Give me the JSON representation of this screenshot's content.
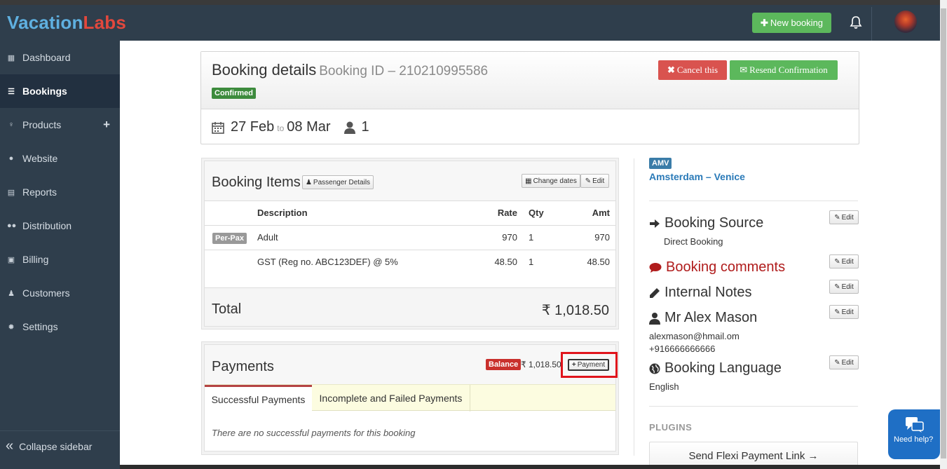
{
  "brand": {
    "part1": "Vacation",
    "part2": "Labs"
  },
  "topbar": {
    "new_booking_label": "New booking",
    "bell_icon": "bell-icon",
    "avatar": "user-avatar"
  },
  "sidebar": {
    "items": [
      {
        "label": "Dashboard",
        "icon": "dashboard-icon"
      },
      {
        "label": "Bookings",
        "icon": "list-icon",
        "active": true
      },
      {
        "label": "Products",
        "icon": "lightbulb-icon"
      },
      {
        "label": "Website",
        "icon": "globe-icon"
      },
      {
        "label": "Reports",
        "icon": "report-icon"
      },
      {
        "label": "Distribution",
        "icon": "users-icon"
      },
      {
        "label": "Billing",
        "icon": "money-icon"
      },
      {
        "label": "Customers",
        "icon": "user-icon"
      },
      {
        "label": "Settings",
        "icon": "gear-icon"
      }
    ],
    "collapse_label": "Collapse sidebar"
  },
  "header": {
    "title": "Booking details",
    "booking_id_text": "Booking ID – 210210995586",
    "status": "Confirmed",
    "cancel_label": "Cancel this",
    "resend_label": "Resend Confirmation",
    "date_from": "27 Feb",
    "date_to_word": "to",
    "date_to": "08 Mar",
    "pax_count": "1"
  },
  "booking_items": {
    "title": "Booking Items",
    "passenger_details_label": "Passenger Details",
    "change_dates_label": "Change dates",
    "edit_label": "Edit",
    "columns": {
      "description": "Description",
      "rate": "Rate",
      "qty": "Qty",
      "amt": "Amt"
    },
    "rows": [
      {
        "tag": "Per-Pax",
        "description": "Adult",
        "rate": "970",
        "qty": "1",
        "amt": "970"
      },
      {
        "tag": "",
        "description": "GST (Reg no. ABC123DEF) @ 5%",
        "rate": "48.50",
        "qty": "1",
        "amt": "48.50"
      }
    ],
    "total_label": "Total",
    "total_value": "₹ 1,018.50"
  },
  "payments": {
    "title": "Payments",
    "balance_label": "Balance",
    "balance_amount": "₹ 1,018.50",
    "add_payment_label": "Payment",
    "tabs": [
      {
        "label": "Successful Payments",
        "active": true
      },
      {
        "label": "Incomplete and Failed Payments",
        "active": false
      }
    ],
    "empty_message": "There are no successful payments for this booking"
  },
  "right": {
    "product_code": "AMV",
    "product_name": "Amsterdam – Venice",
    "booking_source_title": "Booking Source",
    "booking_source_value": "Direct Booking",
    "booking_comments_title": "Booking comments",
    "internal_notes_title": "Internal Notes",
    "customer_name": "Mr Alex Mason",
    "customer_email": "alexmason@hmail.om",
    "customer_phone": "+916666666666",
    "booking_language_title": "Booking Language",
    "booking_language_value": "English",
    "edit_label": "Edit",
    "plugins_heading": "PLUGINS",
    "flexi_link_label": "Send Flexi Payment Link →"
  },
  "help_widget": {
    "label": "Need help?"
  },
  "colors": {
    "sidebar_bg": "#2f3e4c",
    "success": "#5cb85c",
    "danger": "#d9534f",
    "link": "#2a7ab8",
    "highlight_box": "#e0141c"
  }
}
